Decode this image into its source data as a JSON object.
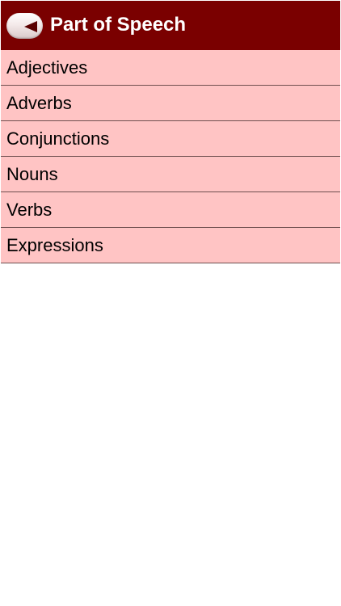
{
  "header": {
    "title": "Part of Speech",
    "back_icon": "back-arrow-icon",
    "background_color": "#7a0000"
  },
  "list": {
    "background_color": "#ffc4c4",
    "items": [
      {
        "label": "Adjectives"
      },
      {
        "label": "Adverbs"
      },
      {
        "label": "Conjunctions"
      },
      {
        "label": "Nouns"
      },
      {
        "label": "Verbs"
      },
      {
        "label": "Expressions"
      }
    ]
  }
}
